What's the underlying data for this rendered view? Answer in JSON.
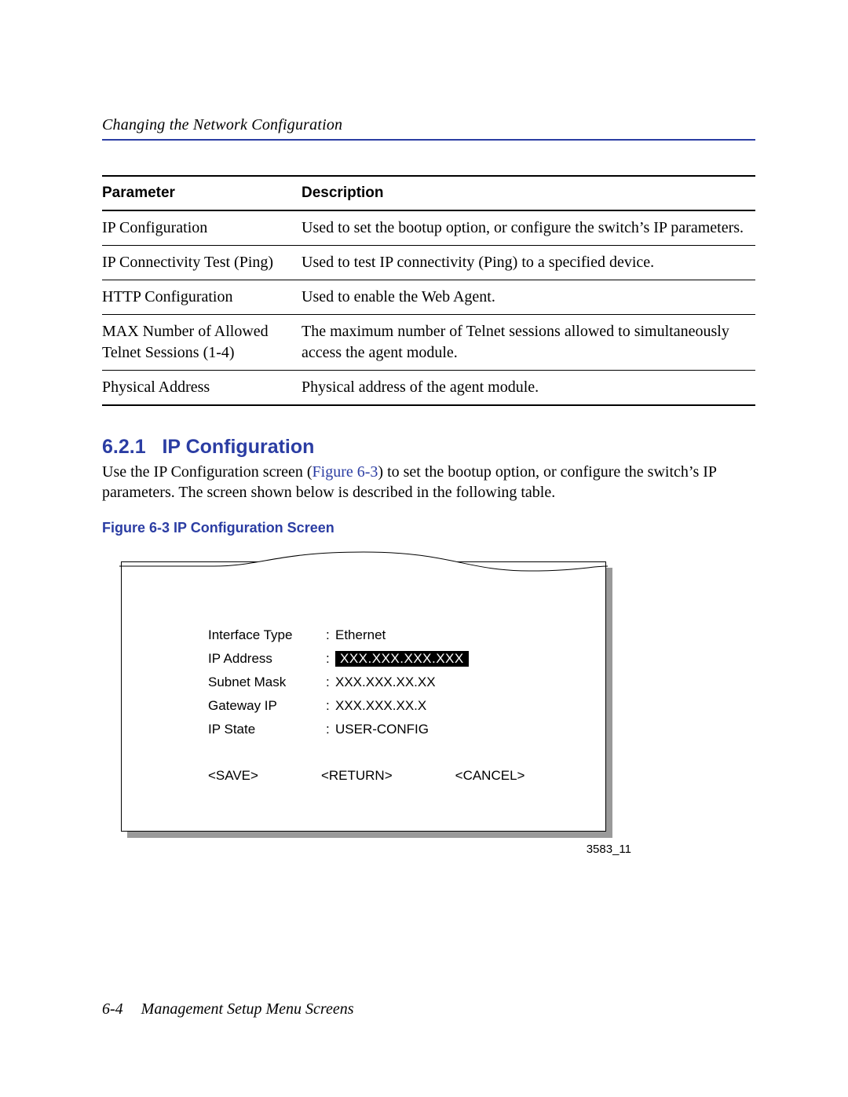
{
  "running_head": "Changing the Network Configuration",
  "table": {
    "headers": [
      "Parameter",
      "Description"
    ],
    "rows": [
      {
        "param": "IP Configuration",
        "desc": "Used to set the bootup option, or configure the switch’s IP parameters."
      },
      {
        "param": "IP Connectivity Test (Ping)",
        "desc": "Used to test IP connectivity (Ping) to a specified device."
      },
      {
        "param": "HTTP Configuration",
        "desc": "Used to enable the Web Agent."
      },
      {
        "param": "MAX Number of Allowed Telnet Sessions (1-4)",
        "desc": "The maximum number of Telnet sessions allowed to simultaneously access the agent module."
      },
      {
        "param": "Physical Address",
        "desc": "Physical address of the agent module."
      }
    ]
  },
  "section": {
    "number": "6.2.1",
    "title": "IP Configuration",
    "body_pre": "Use the IP Configuration screen (",
    "body_ref": "Figure 6-3",
    "body_post": ") to set the bootup option, or configure the switch’s IP parameters. The screen shown below is described in the following table."
  },
  "figure": {
    "caption": "Figure 6-3   IP Configuration Screen",
    "id": "3583_11",
    "rows": [
      {
        "label": "Interface Type",
        "value": "Ethernet",
        "inverse": false
      },
      {
        "label": "IP Address",
        "value": "XXX.XXX.XXX.XXX",
        "inverse": true
      },
      {
        "label": "Subnet Mask",
        "value": "XXX.XXX.XX.XX",
        "inverse": false
      },
      {
        "label": "Gateway IP",
        "value": "XXX.XXX.XX.X",
        "inverse": false
      },
      {
        "label": "IP State",
        "value": "USER-CONFIG",
        "inverse": false
      }
    ],
    "buttons": [
      "<SAVE>",
      "<RETURN>",
      "<CANCEL>"
    ]
  },
  "footer": {
    "page": "6-4",
    "title": "Management Setup Menu Screens"
  }
}
